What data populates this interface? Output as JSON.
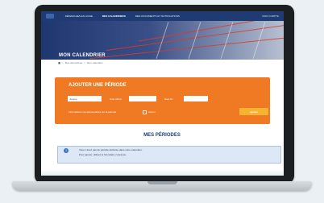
{
  "nav": {
    "items": [
      {
        "label": "· DÉMARCHES EN LIGNE"
      },
      {
        "label": "MES CALENDRIERS"
      },
      {
        "label": "MES DOCUMENTS ET NOTIFICATIONS"
      }
    ],
    "right_label": "MON COMPTE"
  },
  "banner": {
    "title": "MON CALENDRIER"
  },
  "breadcrumb": {
    "items": [
      "Mes démarches",
      "Mon calendrier"
    ],
    "separator": ">"
  },
  "add_period": {
    "title": "AJOUTER UNE PÉRIODE",
    "fields": [
      {
        "label": "",
        "value": "Jusque"
      },
      {
        "label": "Date début",
        "value": ""
      },
      {
        "label": "Date fin",
        "value": ""
      }
    ],
    "checkbox_label": "Informations complémentaires sur la période",
    "checkbox_option": "Aucun",
    "button_label": "Ajouter"
  },
  "my_periods": {
    "title": "MES PÉRIODES",
    "info_icon": "i",
    "info_lines": [
      "Vous n'avez pas de période déclarée dans votre calendrier.",
      "Pour ajouter, utilisez le formulaire ci-dessus."
    ]
  },
  "colors": {
    "nav": "#1f3b74",
    "orange": "#ef7a23",
    "button": "#f5b330",
    "info_bg": "#dce8f5",
    "calendar_line": "#dc3a2a"
  }
}
